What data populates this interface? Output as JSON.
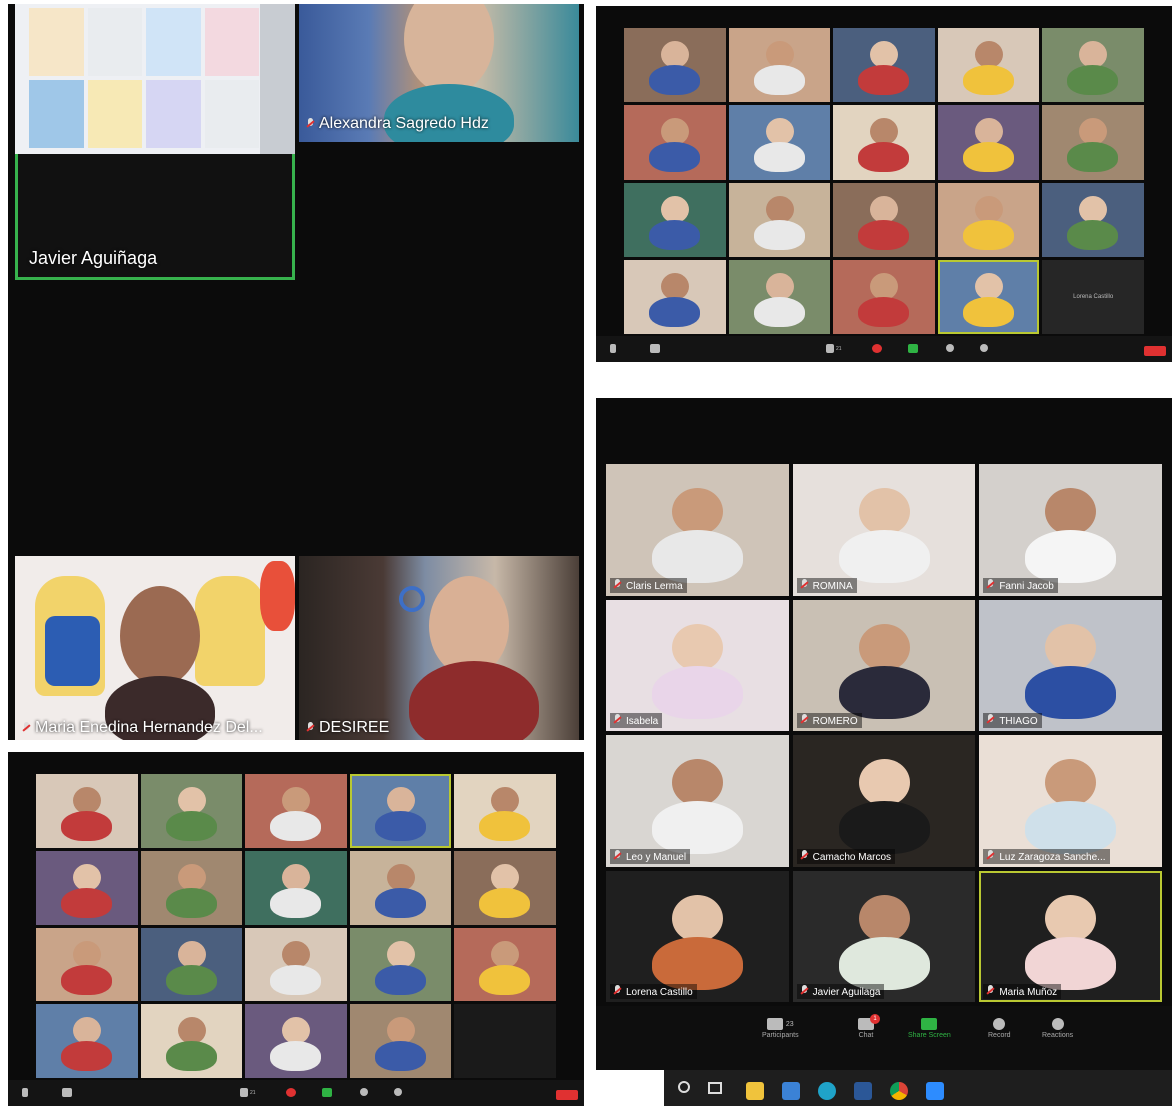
{
  "colors": {
    "speaker_border": "#37b24d",
    "active_border": "#b9c832",
    "end_button": "#e03131",
    "share_screen": "#2fb344",
    "panel_bg": "#0b0b0b"
  },
  "panel_a": {
    "tiles": [
      {
        "name": "",
        "scene": "card-sheet"
      },
      {
        "name": "Alexandra Sagredo Hdz",
        "scene": "woman-dark"
      },
      {
        "name": "Javier Aguiñaga",
        "scene": "dark"
      },
      {
        "name": "Maria Enedina Hernandez Del...",
        "scene": "woman-bee-wall"
      },
      {
        "name": "DESIREE",
        "scene": "girl"
      }
    ]
  },
  "panel_b": {
    "lone_tile_label": "Lorena Castillo",
    "toolbar_count": "21"
  },
  "panel_c": {
    "toolbar_count": "21"
  },
  "panel_d": {
    "tiles": [
      {
        "name": "Claris Lerma"
      },
      {
        "name": "ROMINA"
      },
      {
        "name": "Fanni Jacob"
      },
      {
        "name": "Isabela"
      },
      {
        "name": "ROMERO"
      },
      {
        "name": "THIAGO"
      },
      {
        "name": "Leo y Manuel"
      },
      {
        "name": "Camacho Marcos"
      },
      {
        "name": "Luz Zaragoza Sanche..."
      },
      {
        "name": "Lorena Castillo"
      },
      {
        "name": "Javier Aguilaga"
      },
      {
        "name": "Maria Muñoz"
      }
    ],
    "toolbar": {
      "participants_label": "Participants",
      "participants_count": "23",
      "chat_label": "Chat",
      "chat_badge": "1",
      "share_label": "Share Screen",
      "record_label": "Record",
      "reactions_label": "Reactions"
    }
  }
}
